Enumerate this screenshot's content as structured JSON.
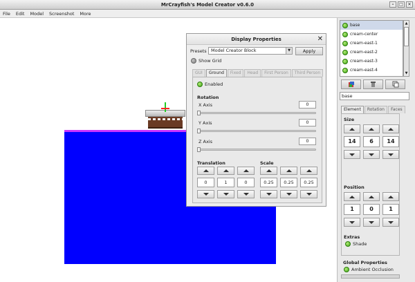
{
  "window": {
    "title": "MrCrayfish's Model Creator v0.6.0"
  },
  "menu": [
    "File",
    "Edit",
    "Model",
    "Screenshot",
    "More"
  ],
  "dialog": {
    "title": "Display Properties",
    "presets_label": "Presets",
    "preset_value": "Model Creator Block",
    "apply_label": "Apply",
    "show_grid_label": "Show Grid",
    "tabs": [
      "GUI",
      "Ground",
      "Fixed",
      "Head",
      "First Person",
      "Third Person"
    ],
    "active_tab": "Ground",
    "enabled_label": "Enabled",
    "rotation": {
      "heading": "Rotation",
      "x_label": "X Axis",
      "x_value": "0",
      "y_label": "Y Axis",
      "y_value": "0",
      "z_label": "Z Axis",
      "z_value": "0"
    },
    "translation": {
      "heading": "Translation",
      "values": [
        "0",
        "1",
        "0"
      ]
    },
    "scale": {
      "heading": "Scale",
      "values": [
        "0.25",
        "0.25",
        "0.25"
      ]
    }
  },
  "elements": {
    "items": [
      "base",
      "cream-center",
      "cream-east-1",
      "cream-east-2",
      "cream-east-3",
      "cream-east-4"
    ],
    "selected": "base"
  },
  "element_name": "base",
  "props_tabs": [
    "Element",
    "Rotation",
    "Faces"
  ],
  "size": {
    "heading": "Size",
    "values": [
      "14",
      "6",
      "14"
    ]
  },
  "position": {
    "heading": "Position",
    "values": [
      "1",
      "0",
      "1"
    ]
  },
  "extras": {
    "heading": "Extras",
    "shade_label": "Shade"
  },
  "global": {
    "heading": "Global Properties",
    "ambient_label": "Ambient Occlusion"
  },
  "colors": {
    "block": "#0000ff",
    "block_edge": "#cc33ff",
    "enabled_dot": "#3aa112"
  }
}
